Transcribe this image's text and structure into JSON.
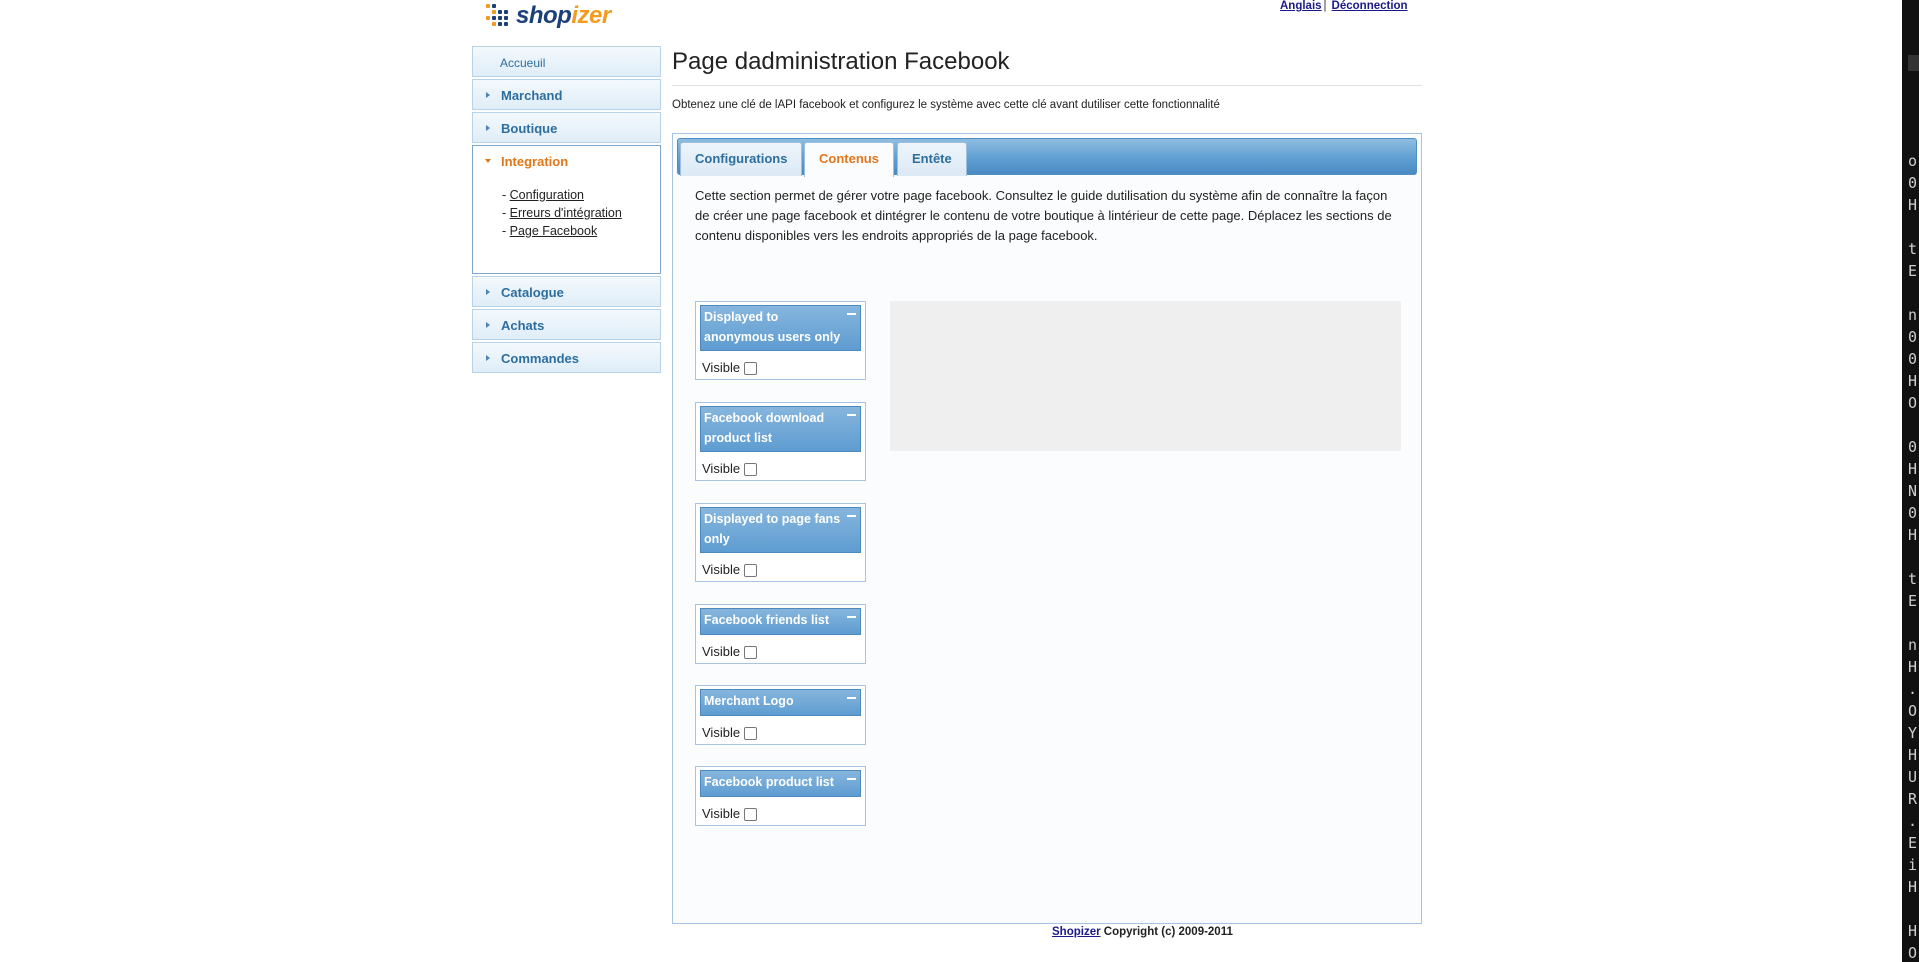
{
  "header": {
    "logo_part1": "shop",
    "logo_part2": "izer",
    "language_link": "Anglais",
    "separator": "|",
    "logout_link": "Déconnection"
  },
  "sidebar": {
    "home": "Accueuil",
    "items": [
      {
        "label": "Marchand"
      },
      {
        "label": "Boutique"
      },
      {
        "label": "Integration",
        "expanded": true,
        "subitems": [
          "Configuration",
          "Erreurs d'intégration",
          "Page Facebook"
        ]
      },
      {
        "label": "Catalogue"
      },
      {
        "label": "Achats"
      },
      {
        "label": "Commandes"
      }
    ],
    "bullet": "- "
  },
  "page": {
    "title": "Page dadministration Facebook",
    "intro": "Obtenez une clé de lAPI facebook et configurez le système avec cette clé avant dutiliser cette fonctionnalité"
  },
  "tabs": [
    {
      "label": "Configurations"
    },
    {
      "label": "Contenus",
      "active": true
    },
    {
      "label": "Entête"
    }
  ],
  "section_text": "Cette section permet de gérer votre page facebook. Consultez le guide dutilisation du système afin de connaître la façon de créer une page facebook et dintégrer le contenu de votre boutique à lintérieur de cette page. Déplacez les sections de contenu disponibles vers les endroits appropriés de la page facebook.",
  "widgets": [
    {
      "title": "Displayed to anonymous users only",
      "visible_label": "Visible",
      "checked": false
    },
    {
      "title": "Facebook download product list",
      "visible_label": "Visible",
      "checked": false
    },
    {
      "title": "Displayed to page fans only",
      "visible_label": "Visible",
      "checked": false
    },
    {
      "title": "Facebook friends list",
      "visible_label": "Visible",
      "checked": false
    },
    {
      "title": "Merchant Logo",
      "visible_label": "Visible",
      "checked": false
    },
    {
      "title": "Facebook product list",
      "visible_label": "Visible",
      "checked": false
    }
  ],
  "footer": {
    "link": "Shopizer",
    "text": " Copyright (c) 2009-2011"
  },
  "terminal": {
    "chars": "o\n0\nH\n\nt\nE\n\nn\n0\n0\nH\nO\n\n0\nH\nN\n0\nH\n\nt\nE\n\nn\nH\n.\nO\nY\nH\nU\nR\n.\nE\ni\nH\n\nH\nO"
  },
  "colors": {
    "accent_orange": "#e1771c",
    "link_blue": "#2e6e9e",
    "header_blue": "#5e9cd1"
  }
}
